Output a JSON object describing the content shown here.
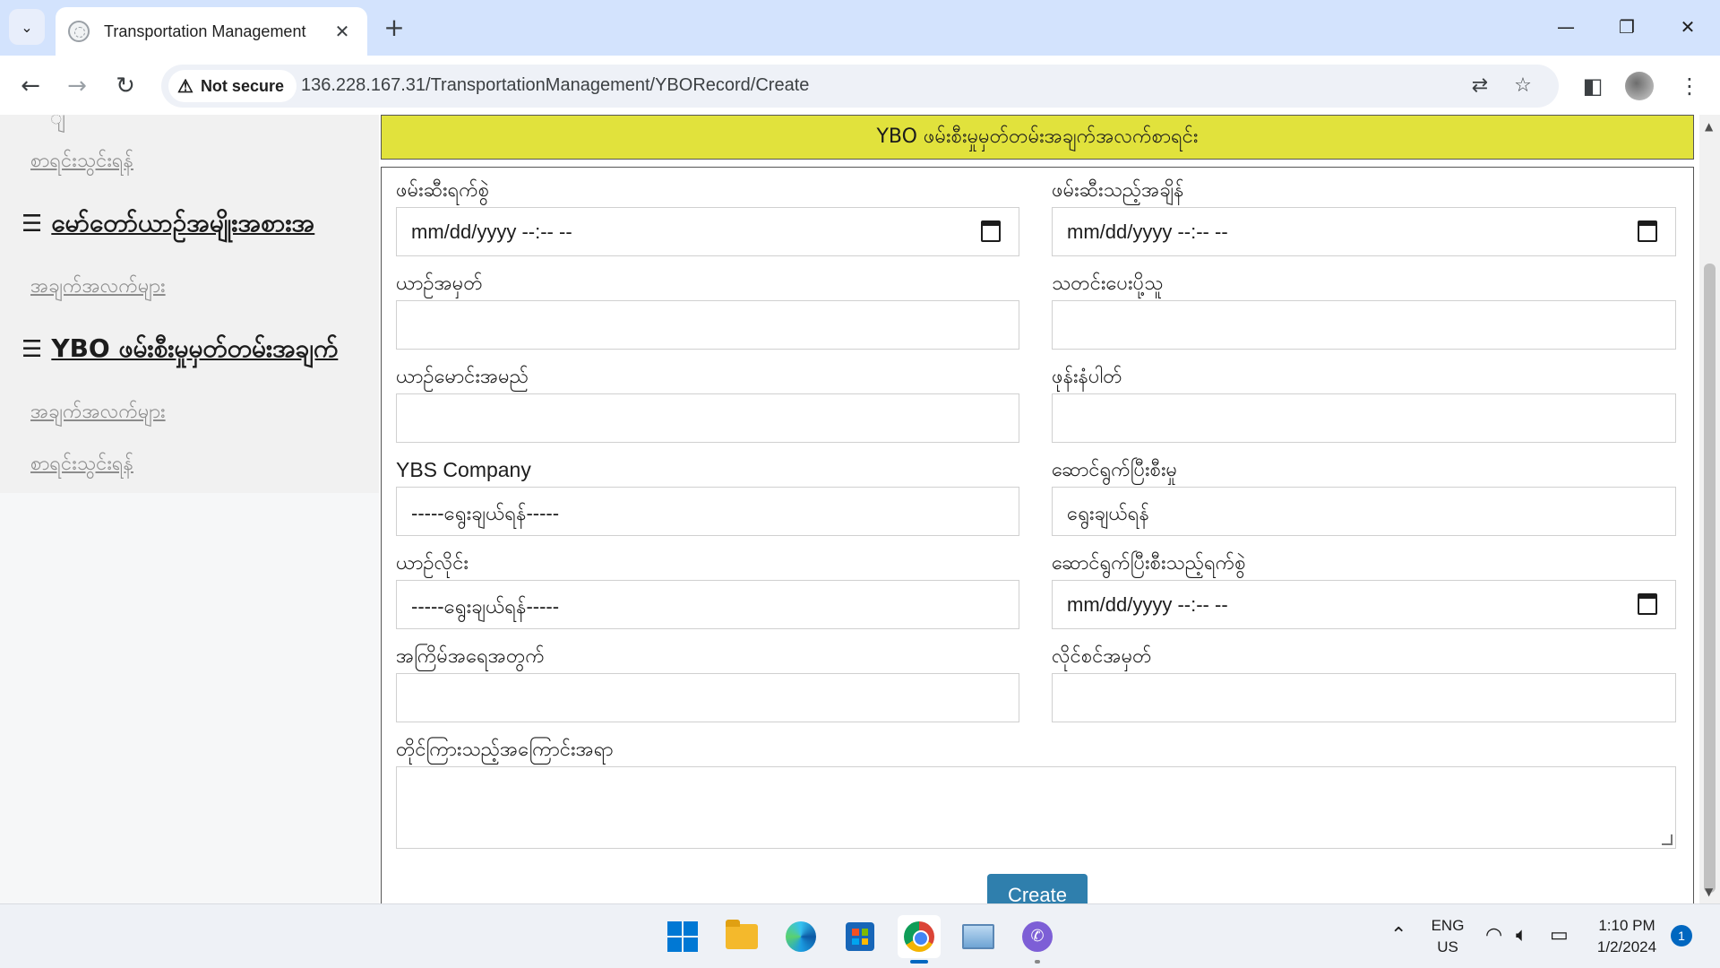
{
  "browser": {
    "tab_title": "Transportation Management",
    "tab_close": "✕",
    "new_tab": "+",
    "security_label": "Not secure",
    "url": "136.228.167.31/TransportationManagement/YBORecord/Create",
    "window_controls": {
      "minimize": "—",
      "restore": "❐",
      "close": "✕"
    }
  },
  "sidebar": {
    "partial_top": "ျ",
    "items": [
      {
        "type": "link",
        "label": "စာရင်းသွင်းရန်"
      },
      {
        "type": "heading",
        "label": "မော်တော်ယာဥ်အမျိုးအစားအ"
      },
      {
        "type": "link",
        "label": "အချက်အလက်များ"
      },
      {
        "type": "heading",
        "label": "YBO ဖမ်းစီးမှုမှတ်တမ်းအချက်"
      },
      {
        "type": "link",
        "label": "အချက်အလက်များ"
      },
      {
        "type": "link",
        "label": "စာရင်းသွင်းရန်"
      }
    ]
  },
  "form": {
    "banner": "YBO ဖမ်းစီးမှုမှတ်တမ်းအချက်အလက်စာရင်း",
    "fields": {
      "arrest_date": {
        "label": "ဖမ်းဆီးရက်စွဲ",
        "value": "mm/dd/yyyy --:-- --"
      },
      "arrest_time": {
        "label": "ဖမ်းဆီးသည့်အချိန်",
        "value": "mm/dd/yyyy --:-- --"
      },
      "vehicle_number": {
        "label": "ယာဥ်အမှတ်",
        "value": ""
      },
      "informant": {
        "label": "သတင်းပေးပို့သူ",
        "value": ""
      },
      "driver_name": {
        "label": "ယာဥ်မောင်းအမည်",
        "value": ""
      },
      "phone": {
        "label": "ဖုန်းနံပါတ်",
        "value": ""
      },
      "ybs_company": {
        "label": "YBS Company",
        "value": "-----ရွေးချယ်ရန်-----"
      },
      "action_status": {
        "label": "ဆောင်ရွက်ပြီးစီးမှု",
        "value": "ရွေးချယ်ရန်"
      },
      "bus_line": {
        "label": "ယာဥ်လိုင်း",
        "value": "-----ရွေးချယ်ရန်-----"
      },
      "action_date": {
        "label": "ဆောင်ရွက်ပြီးစီးသည့်ရက်စွဲ",
        "value": "mm/dd/yyyy --:-- --"
      },
      "offense_count": {
        "label": "အကြိမ်အရေအတွက်",
        "value": ""
      },
      "license_number": {
        "label": "လိုင်စင်အမှတ်",
        "value": ""
      },
      "complaint": {
        "label": "တိုင်ကြားသည့်အကြောင်းအရာ",
        "value": ""
      }
    },
    "submit_label": "Create"
  },
  "taskbar": {
    "language": "ENG",
    "region": "US",
    "time": "1:10 PM",
    "date": "1/2/2024",
    "notification_count": "1"
  },
  "colors": {
    "banner_bg": "#e1e23c",
    "button_bg": "#2f7fad",
    "tabbar_bg": "#d3e3fd"
  }
}
